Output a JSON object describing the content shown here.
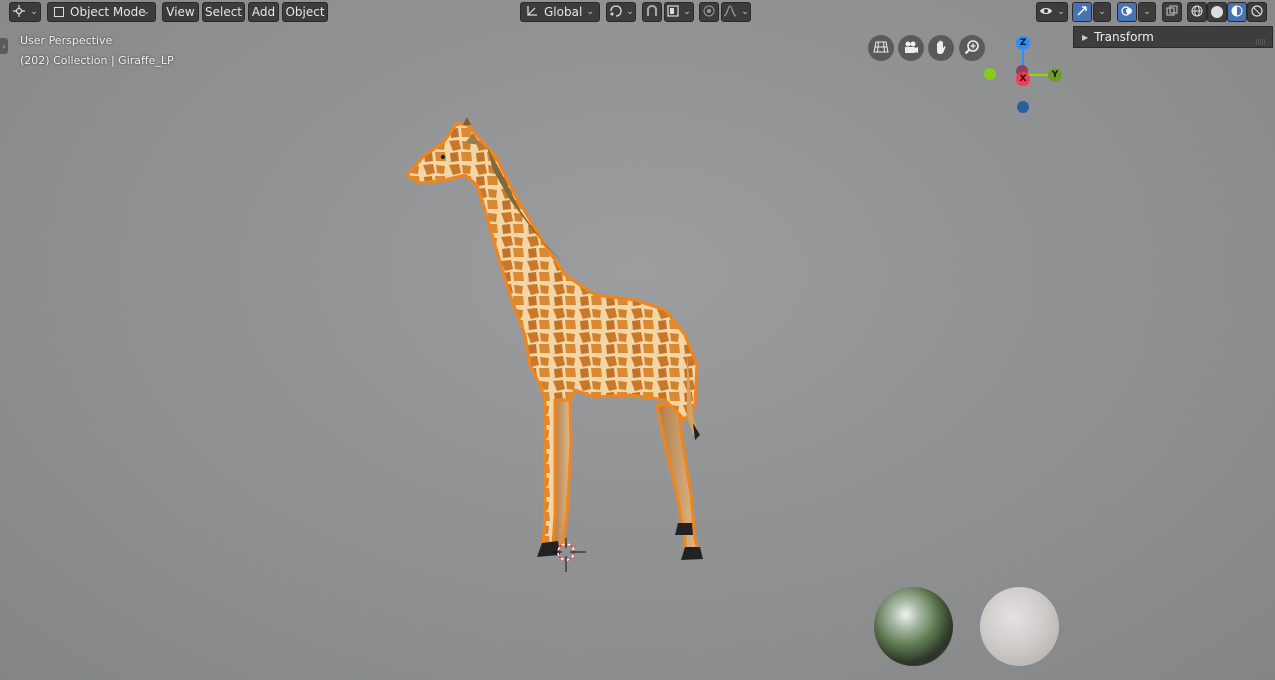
{
  "header": {
    "editor_type_icon": "3d-viewport-icon",
    "mode": "Object Mode",
    "menus": [
      "View",
      "Select",
      "Add",
      "Object"
    ],
    "transform_orientation": "Global",
    "pivot_icon": "pivot-point-icon",
    "snap_icon": "magnet-icon",
    "snap_element_icon": "snap-increment-icon",
    "proportional_icon": "proportional-edit-icon",
    "falloff_icon": "falloff-curve-icon",
    "visibility_icon": "eye-icon",
    "gizmo_icon": "gizmo-icon",
    "overlay_icon": "overlay-icon",
    "xray_icon": "xray-icon",
    "shading_modes": [
      "wireframe-icon",
      "solid-icon",
      "material-preview-icon",
      "rendered-icon"
    ],
    "active_shading": "material-preview-icon"
  },
  "viewport_info": {
    "perspective": "User Perspective",
    "collection": "(202) Collection | Giraffe_LP"
  },
  "nav_buttons": [
    "orthographic-grid-icon",
    "camera-icon",
    "hand-pan-icon",
    "zoom-icon"
  ],
  "axes": {
    "z": "Z",
    "x": "X",
    "y": "Y"
  },
  "sidebar": {
    "transform_label": "Transform"
  },
  "object": {
    "name": "Giraffe_LP",
    "selected": true
  },
  "colors": {
    "accent": "#4772b3",
    "selection_outline": "#f0851e",
    "axis_x": "#ff3352",
    "axis_y": "#8bdc00",
    "axis_z": "#2890ff"
  }
}
